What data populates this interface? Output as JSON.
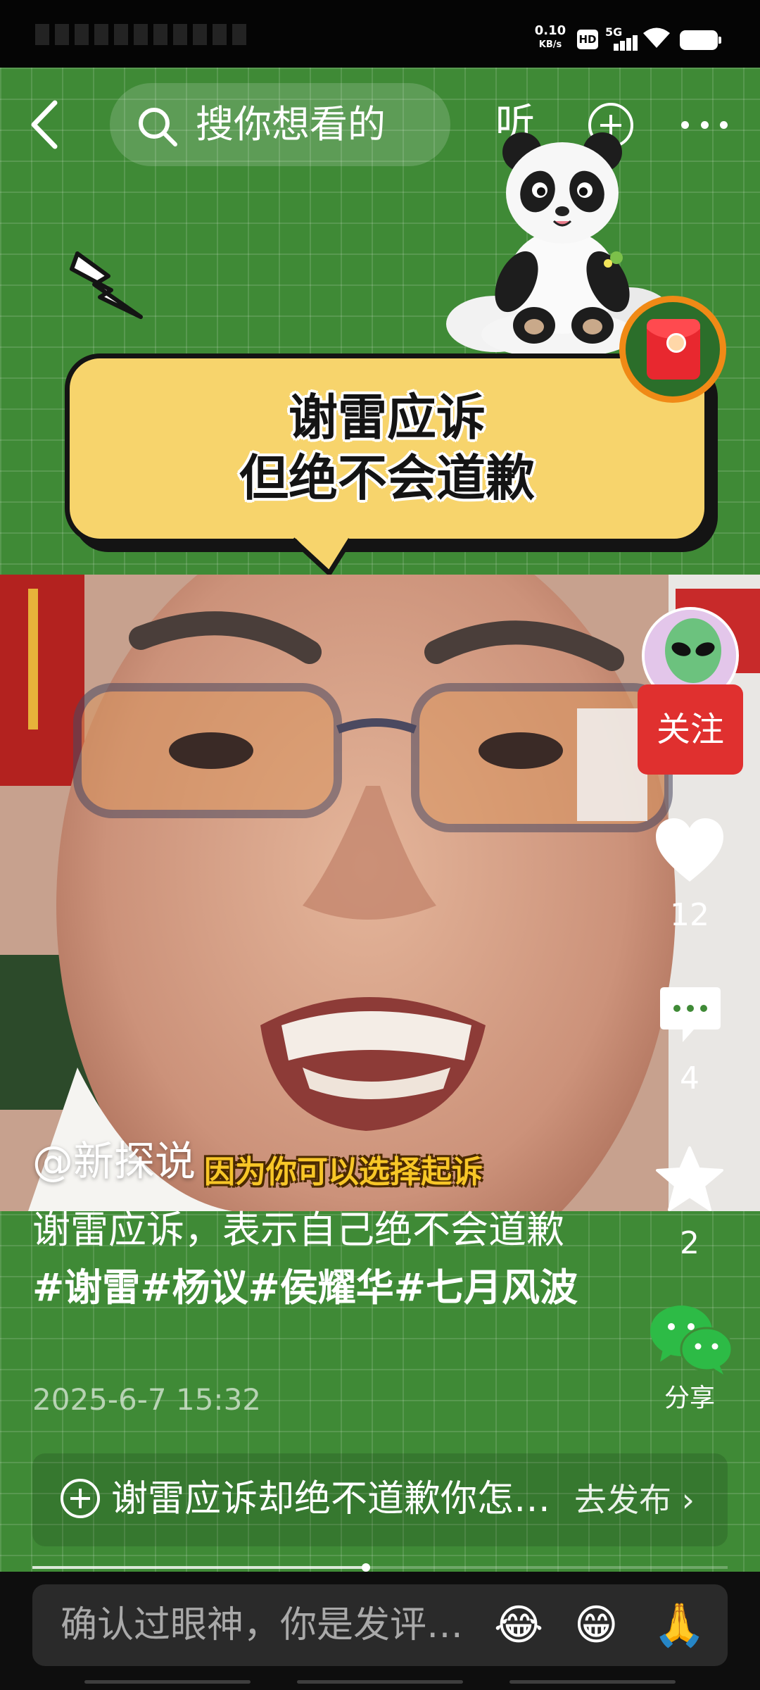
{
  "status_bar": {
    "net_speed_value": "0.10",
    "net_speed_unit": "KB/s",
    "hd_badge": "HD",
    "network_type": "5G"
  },
  "top_nav": {
    "search_placeholder": "搜你想看的",
    "listen_label": "听",
    "icons": [
      "chevron-left-icon",
      "search-icon",
      "plus-circle-icon",
      "more-icon"
    ]
  },
  "sticker": {
    "bubble_line1": "谢雷应诉",
    "bubble_line2": "但绝不会道歉"
  },
  "video": {
    "caption": "因为你可以选择起诉"
  },
  "actions": {
    "follow_label": "关注",
    "like_count": "12",
    "comment_count": "4",
    "favorite_count": "2",
    "share_label": "分享"
  },
  "post": {
    "author": "@新探说",
    "description_text": "谢雷应诉，表示自己绝不会道歉",
    "hashtags": "#谢雷#杨议#侯耀华#七月风波",
    "timestamp": "2025-6-7 15:32"
  },
  "prompt_bar": {
    "text": "谢雷应诉却绝不道歉你怎…",
    "action": "去发布 ›"
  },
  "playback": {
    "progress": 0.48
  },
  "comment_bar": {
    "placeholder": "确认过眼神，你是发评…",
    "emojis": [
      "😂",
      "😁",
      "🙏"
    ]
  },
  "colors": {
    "background_green": "#3f8a36",
    "bubble_yellow": "#f7d46c",
    "follow_red": "#e0302f",
    "caption_yellow": "#f7c627"
  }
}
